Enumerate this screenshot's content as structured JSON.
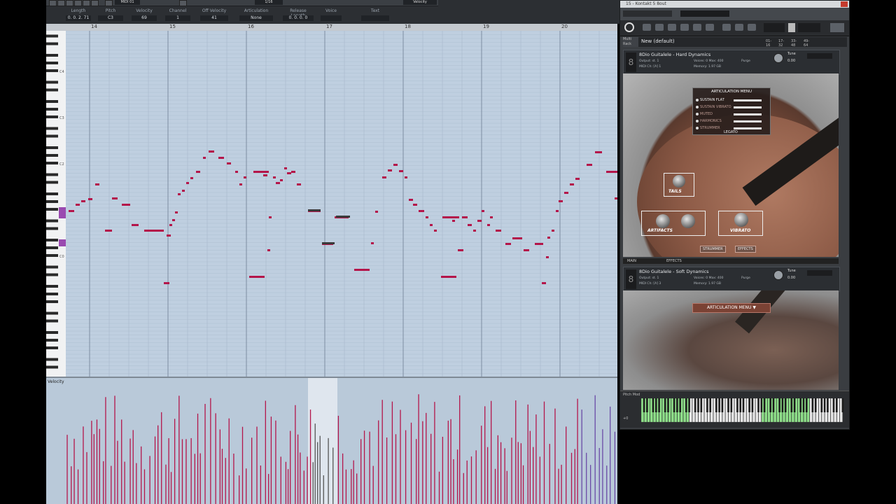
{
  "toolbar": {
    "headers": [
      "Length",
      "Pitch",
      "Velocity",
      "Channel",
      "Off Velocity",
      "Articulation",
      "Release Length",
      "Voice",
      "Text"
    ],
    "values": [
      "0. 0. 2. 71",
      "C3",
      "69",
      "1",
      "41",
      "None",
      "0. 0. 0. 0",
      "",
      ""
    ],
    "quantize": "1/16",
    "velocity_tool": "Velocity",
    "misc_value": "MIDI 01"
  },
  "ruler": {
    "bars": [
      "14",
      "15",
      "16",
      "17",
      "18",
      "19",
      "20"
    ]
  },
  "keyboard_labels": [
    "C4",
    "C3",
    "C2",
    "C1",
    "C0"
  ],
  "velocity_lane": {
    "label": "Velocity"
  },
  "kontakt": {
    "window_title": "15 - Kontakt 5 8out",
    "multi_rack_label": "Multi Rack",
    "preset": "New (default)",
    "rack_ranges": [
      "01-16",
      "17-32",
      "33-48",
      "49-64"
    ],
    "instrument1": {
      "name": "8Dio Guitalele - Hard Dynamics",
      "output": "st. 1",
      "midi": "[A] 1",
      "voices": "0",
      "max": "400",
      "memory": "1.97 GB",
      "purge": "Purge",
      "tune_label": "Tune",
      "tune_value": "0.00",
      "articulation_menu": {
        "title": "ARTICULATION MENU",
        "items": [
          "SUSTAIN FLAT",
          "SUSTAIN VIBRATO",
          "MUTED",
          "HARMONICS",
          "STRUMMER"
        ],
        "legato": "LEGATO"
      },
      "knobs": [
        "TAILS",
        "ARTIFACTS",
        "VIBRATO"
      ],
      "buttons": [
        "STRUMMER",
        "EFFECTS"
      ],
      "tabs": [
        "MAIN",
        "EFFECTS"
      ]
    },
    "instrument2": {
      "name": "8Dio Guitalele - Soft Dynamics",
      "output": "st. 1",
      "midi": "[A] 3",
      "voices": "0",
      "max": "400",
      "memory": "1.97 GB",
      "purge": "Purge",
      "tune_label": "Tune",
      "tune_value": "0.00",
      "articulation_button": "ARTICULATION MENU ▼"
    },
    "keyboard_label": "Pitch Mod",
    "keyboard_octave": "+0"
  },
  "colors": {
    "note": "#b4154a",
    "note_muted": "#3a3a3a",
    "grid_bg": "#bfcfe0",
    "keyboard_highlight": "#8fe08a"
  }
}
